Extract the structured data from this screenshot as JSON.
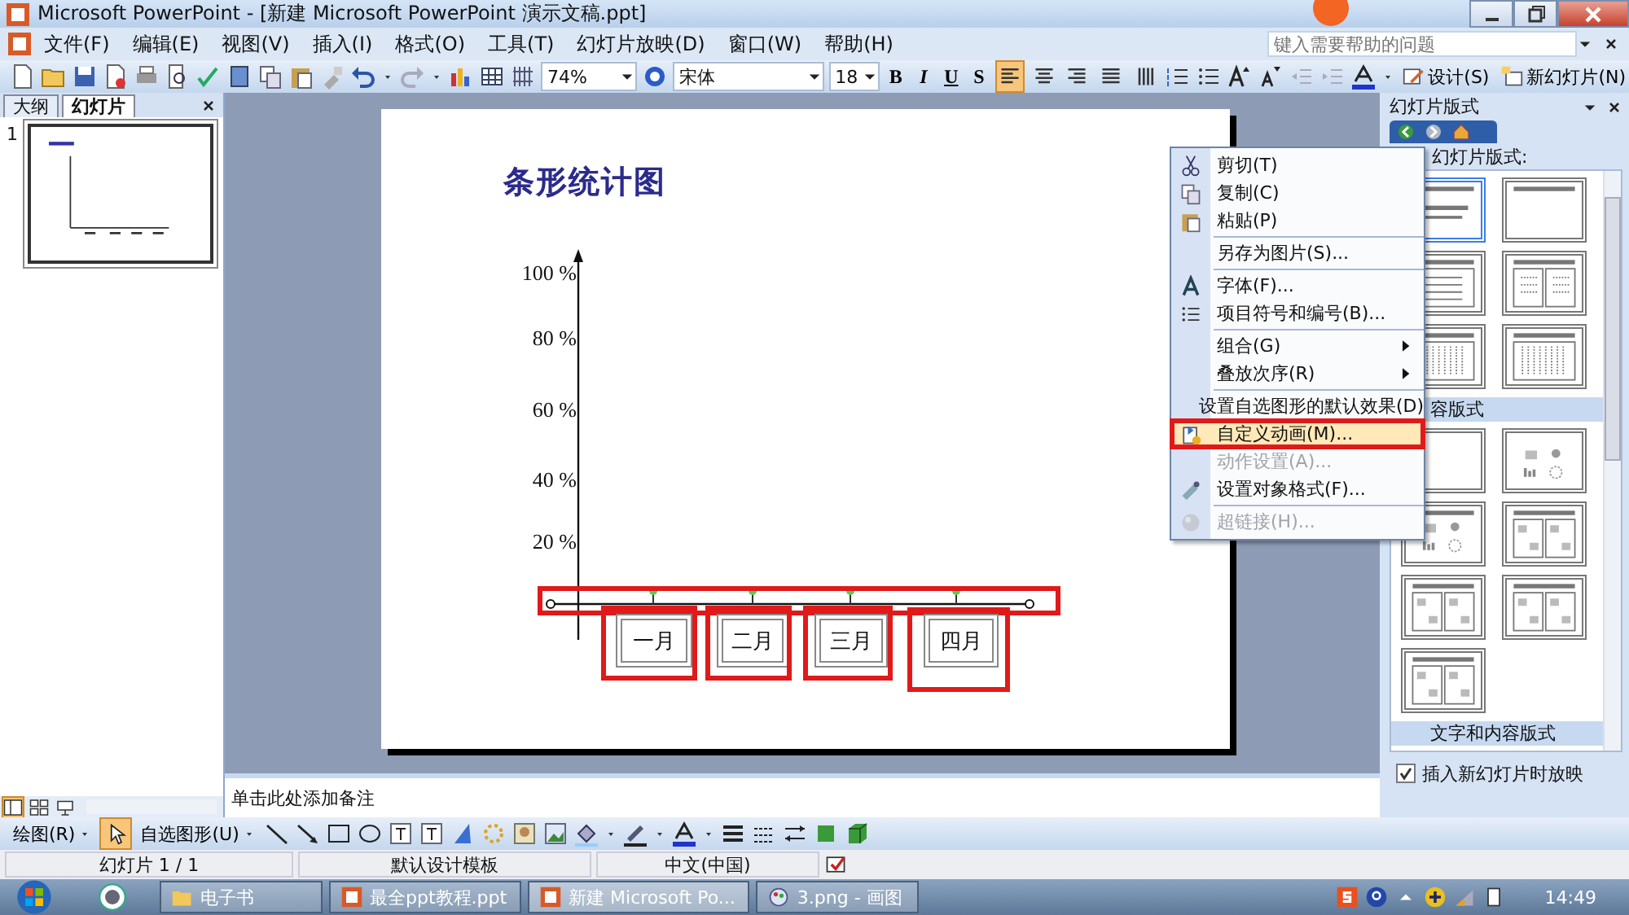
{
  "window": {
    "title": "Microsoft PowerPoint - [新建 Microsoft PowerPoint 演示文稿.ppt]"
  },
  "menu": [
    "文件(F)",
    "编辑(E)",
    "视图(V)",
    "插入(I)",
    "格式(O)",
    "工具(T)",
    "幻灯片放映(D)",
    "窗口(W)",
    "帮助(H)"
  ],
  "help_search": {
    "placeholder": "键入需要帮助的问题"
  },
  "toolbar": {
    "zoom": "74%",
    "font": "宋体",
    "font_size": "18",
    "format_buttons": [
      "B",
      "I",
      "U",
      "S"
    ],
    "alignment_buttons": [
      {
        "selected": true
      },
      {
        "selected": false
      },
      {
        "selected": false
      },
      {
        "selected": false
      },
      {
        "selected": false
      }
    ],
    "design": "设计(S)",
    "new_slide": "新幻灯片(N)"
  },
  "left_panel": {
    "tabs": [
      {
        "label": "大纲",
        "selected": false
      },
      {
        "label": "幻灯片",
        "selected": true
      }
    ],
    "slide_number": "1"
  },
  "slide": {
    "title": "条形统计图",
    "axis_labels": [
      "100 %",
      "80 %",
      "60 %",
      "40 %",
      "20 %"
    ],
    "months": [
      "一月",
      "二月",
      "三月",
      "四月"
    ]
  },
  "notes": "单击此处添加备注",
  "context_menu": [
    {
      "label": "剪切(T)",
      "kind": "item",
      "disabled": false,
      "selected": false,
      "separator_before": false
    },
    {
      "label": "复制(C)",
      "kind": "item",
      "disabled": false,
      "selected": false,
      "separator_before": false
    },
    {
      "label": "粘贴(P)",
      "kind": "item",
      "disabled": false,
      "selected": false,
      "separator_before": false
    },
    {
      "label": "另存为图片(S)...",
      "kind": "item",
      "disabled": false,
      "selected": false,
      "separator_before": true
    },
    {
      "label": "字体(F)...",
      "kind": "item",
      "disabled": false,
      "selected": false,
      "separator_before": true
    },
    {
      "label": "项目符号和编号(B)...",
      "kind": "item",
      "disabled": false,
      "selected": false,
      "separator_before": false
    },
    {
      "label": "组合(G)",
      "kind": "submenu",
      "disabled": false,
      "selected": false,
      "separator_before": true
    },
    {
      "label": "叠放次序(R)",
      "kind": "submenu",
      "disabled": false,
      "selected": false,
      "separator_before": false
    },
    {
      "label": "设置自选图形的默认效果(D)",
      "kind": "item",
      "disabled": false,
      "selected": false,
      "separator_before": true
    },
    {
      "label": "自定义动画(M)...",
      "kind": "item",
      "disabled": false,
      "selected": true,
      "separator_before": false
    },
    {
      "label": "动作设置(A)...",
      "kind": "item",
      "disabled": true,
      "selected": false,
      "separator_before": false
    },
    {
      "label": "设置对象格式(F)...",
      "kind": "item",
      "disabled": false,
      "selected": false,
      "separator_before": false
    },
    {
      "label": "超链接(H)...",
      "kind": "item",
      "disabled": true,
      "selected": false,
      "separator_before": true
    }
  ],
  "task_pane": {
    "title": "幻灯片版式",
    "apply_label": "幻灯片版式:",
    "sections": [
      {
        "layouts": [
          {
            "kind": "title",
            "selected": true
          },
          {
            "kind": "title-only",
            "selected": false
          },
          {
            "kind": "bullets",
            "selected": false
          },
          {
            "kind": "two-bullets",
            "selected": false
          },
          {
            "kind": "vertical",
            "selected": false
          },
          {
            "kind": "vertical-full",
            "selected": false
          }
        ]
      },
      {
        "heading": "容版式",
        "layouts": [
          {
            "kind": "blank",
            "selected": false
          },
          {
            "kind": "content",
            "selected": false
          },
          {
            "kind": "title-content",
            "selected": false
          },
          {
            "kind": "two-content",
            "selected": false
          },
          {
            "kind": "three-content",
            "selected": false
          },
          {
            "kind": "three-content-b",
            "selected": false
          },
          {
            "kind": "four-content",
            "selected": false
          }
        ]
      },
      {
        "heading": "文字和内容版式"
      }
    ],
    "show_on_insert": {
      "label": "插入新幻灯片时放映",
      "checked": true
    }
  },
  "drawing_toolbar": {
    "draw": "绘图(R)",
    "autoshapes": "自选图形(U)"
  },
  "status_bar": [
    "幻灯片 1 / 1",
    "默认设计模板",
    "中文(中国)"
  ],
  "taskbar": {
    "items": [
      "电子书",
      "最全ppt教程.ppt",
      "新建 Microsoft Po...",
      "3.png - 画图"
    ],
    "clock": "14:49"
  }
}
